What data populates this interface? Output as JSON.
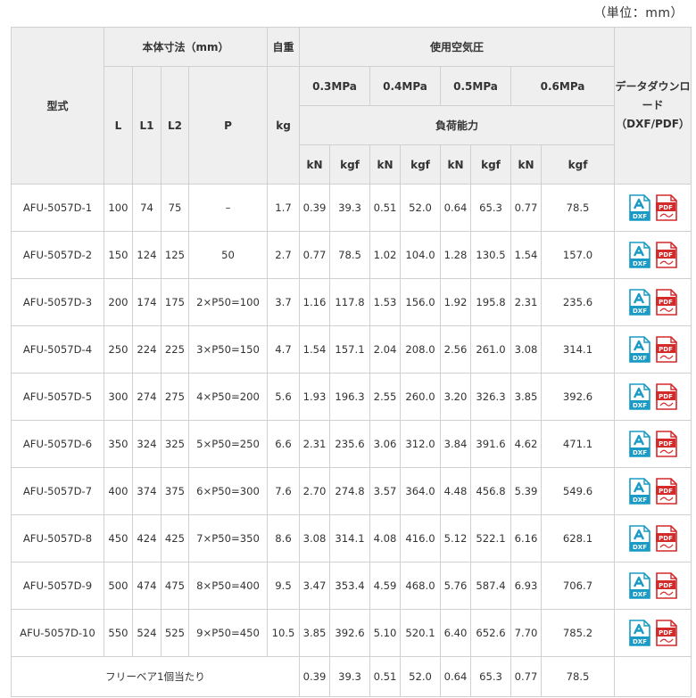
{
  "unit_note": "（単位：mm）",
  "headers": {
    "model": "型式",
    "dimensions": "本体寸法（mm）",
    "weight": "自重",
    "pressure": "使用空気圧",
    "download": "データダウンロード（DXF/PDF）",
    "L": "L",
    "L1": "L1",
    "L2": "L2",
    "P": "P",
    "kg": "kg",
    "p03": "0.3MPa",
    "p04": "0.4MPa",
    "p05": "0.5MPa",
    "p06": "0.6MPa",
    "capacity": "負荷能力",
    "kN": "kN",
    "kgf": "kgf"
  },
  "icons": {
    "dxf": "DXF",
    "pdf": "PDF"
  },
  "rows": [
    {
      "model": "AFU-5057D-1",
      "L": "100",
      "L1": "74",
      "L2": "75",
      "P": "–",
      "kg": "1.7",
      "kN03": "0.39",
      "kgf03": "39.3",
      "kN04": "0.51",
      "kgf04": "52.0",
      "kN05": "0.64",
      "kgf05": "65.3",
      "kN06": "0.77",
      "kgf06": "78.5"
    },
    {
      "model": "AFU-5057D-2",
      "L": "150",
      "L1": "124",
      "L2": "125",
      "P": "50",
      "kg": "2.7",
      "kN03": "0.77",
      "kgf03": "78.5",
      "kN04": "1.02",
      "kgf04": "104.0",
      "kN05": "1.28",
      "kgf05": "130.5",
      "kN06": "1.54",
      "kgf06": "157.0"
    },
    {
      "model": "AFU-5057D-3",
      "L": "200",
      "L1": "174",
      "L2": "175",
      "P": "2×P50=100",
      "kg": "3.7",
      "kN03": "1.16",
      "kgf03": "117.8",
      "kN04": "1.53",
      "kgf04": "156.0",
      "kN05": "1.92",
      "kgf05": "195.8",
      "kN06": "2.31",
      "kgf06": "235.6"
    },
    {
      "model": "AFU-5057D-4",
      "L": "250",
      "L1": "224",
      "L2": "225",
      "P": "3×P50=150",
      "kg": "4.7",
      "kN03": "1.54",
      "kgf03": "157.1",
      "kN04": "2.04",
      "kgf04": "208.0",
      "kN05": "2.56",
      "kgf05": "261.0",
      "kN06": "3.08",
      "kgf06": "314.1"
    },
    {
      "model": "AFU-5057D-5",
      "L": "300",
      "L1": "274",
      "L2": "275",
      "P": "4×P50=200",
      "kg": "5.6",
      "kN03": "1.93",
      "kgf03": "196.3",
      "kN04": "2.55",
      "kgf04": "260.0",
      "kN05": "3.20",
      "kgf05": "326.3",
      "kN06": "3.85",
      "kgf06": "392.6"
    },
    {
      "model": "AFU-5057D-6",
      "L": "350",
      "L1": "324",
      "L2": "325",
      "P": "5×P50=250",
      "kg": "6.6",
      "kN03": "2.31",
      "kgf03": "235.6",
      "kN04": "3.06",
      "kgf04": "312.0",
      "kN05": "3.84",
      "kgf05": "391.6",
      "kN06": "4.62",
      "kgf06": "471.1"
    },
    {
      "model": "AFU-5057D-7",
      "L": "400",
      "L1": "374",
      "L2": "375",
      "P": "6×P50=300",
      "kg": "7.6",
      "kN03": "2.70",
      "kgf03": "274.8",
      "kN04": "3.57",
      "kgf04": "364.0",
      "kN05": "4.48",
      "kgf05": "456.8",
      "kN06": "5.39",
      "kgf06": "549.6"
    },
    {
      "model": "AFU-5057D-8",
      "L": "450",
      "L1": "424",
      "L2": "425",
      "P": "7×P50=350",
      "kg": "8.6",
      "kN03": "3.08",
      "kgf03": "314.1",
      "kN04": "4.08",
      "kgf04": "416.0",
      "kN05": "5.12",
      "kgf05": "522.1",
      "kN06": "6.16",
      "kgf06": "628.1"
    },
    {
      "model": "AFU-5057D-9",
      "L": "500",
      "L1": "474",
      "L2": "475",
      "P": "8×P50=400",
      "kg": "9.5",
      "kN03": "3.47",
      "kgf03": "353.4",
      "kN04": "4.59",
      "kgf04": "468.0",
      "kN05": "5.76",
      "kgf05": "587.4",
      "kN06": "6.93",
      "kgf06": "706.7"
    },
    {
      "model": "AFU-5057D-10",
      "L": "550",
      "L1": "524",
      "L2": "525",
      "P": "9×P50=450",
      "kg": "10.5",
      "kN03": "3.85",
      "kgf03": "392.6",
      "kN04": "5.10",
      "kgf04": "520.1",
      "kN05": "6.40",
      "kgf05": "652.6",
      "kN06": "7.70",
      "kgf06": "785.2"
    }
  ],
  "footer": {
    "label": "フリーベア1個当たり",
    "kN03": "0.39",
    "kgf03": "39.3",
    "kN04": "0.51",
    "kgf04": "52.0",
    "kN05": "0.64",
    "kgf05": "65.3",
    "kN06": "0.77",
    "kgf06": "78.5"
  },
  "colors": {
    "dxf_icon": "#1a9bc6",
    "pdf_icon": "#d42a2a",
    "header_bg": "#efefef",
    "border": "#d0d0d0"
  }
}
